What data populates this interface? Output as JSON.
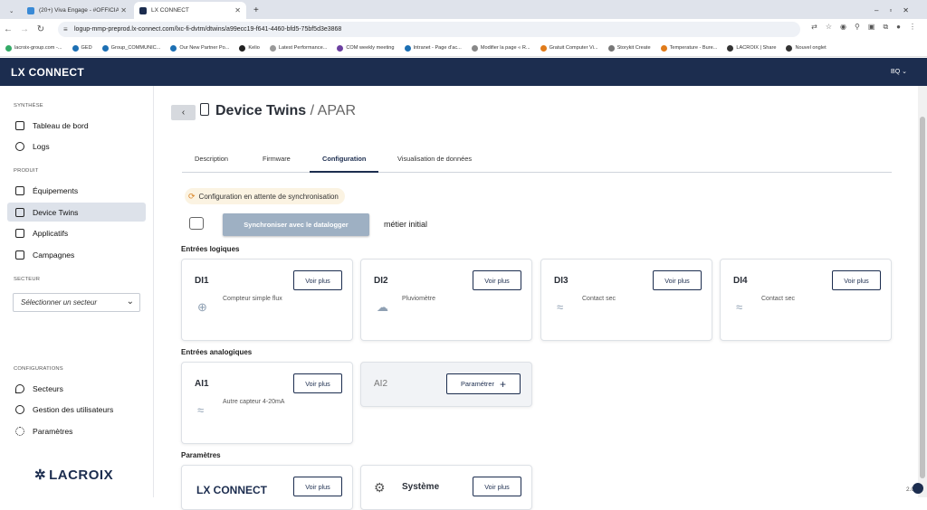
{
  "browser": {
    "tabs": [
      {
        "title": "(20+) Viva Engage - #OFFICIAL"
      },
      {
        "title": "LX CONNECT"
      }
    ],
    "url": "logup-mmp-preprod.lx-connect.com/lxc-fi-dvtm/dtwins/a99ecc19-f641-4460-bfd5-75bf5d3e3868",
    "bookmarks": [
      "lacroix-group.com -...",
      "GED",
      "Group_COMMUNIC...",
      "Our New Partner Po...",
      "Kelio",
      "Latest Performance...",
      "COM weekly meeting",
      "Intranet - Page d'ac...",
      "Modifier la page « R...",
      "Gratuit Computer Vi...",
      "Storykit Create",
      "Temperature - Bure...",
      "LACROIX | Share",
      "Nouvel onglet"
    ]
  },
  "app": {
    "brand": "LX CONNECT",
    "user": "BQ"
  },
  "sidebar": {
    "section_synthese": "SYNTHÈSE",
    "tableau": "Tableau de bord",
    "logs": "Logs",
    "section_produit": "PRODUIT",
    "equipements": "Équipements",
    "device_twins": "Device Twins",
    "applicatifs": "Applicatifs",
    "campagnes": "Campagnes",
    "section_secteur": "SECTEUR",
    "secteur_placeholder": "Sélectionner un secteur",
    "section_config": "CONFIGURATIONS",
    "secteurs": "Secteurs",
    "gestion": "Gestion des utilisateurs",
    "parametres": "Paramètres",
    "logo": "LACROIX"
  },
  "page": {
    "title": "Device Twins",
    "subtitle": "/ APAR",
    "tabs": [
      "Description",
      "Firmware",
      "Configuration",
      "Visualisation de données"
    ],
    "pending": "Configuration en attente de synchronisation",
    "sync_button": "Synchroniser avec le datalogger",
    "metier": "métier initial",
    "group_logiques": "Entrées logiques",
    "group_analogiques": "Entrées analogiques",
    "group_parametres": "Paramètres",
    "voir_plus": "Voir plus",
    "parametrer": "Paramétrer"
  },
  "logic_inputs": [
    {
      "name": "DI1",
      "desc": "Compteur simple flux"
    },
    {
      "name": "DI2",
      "desc": "Pluviomètre"
    },
    {
      "name": "DI3",
      "desc": "Contact sec"
    },
    {
      "name": "DI4",
      "desc": "Contact sec"
    }
  ],
  "analog_inputs": [
    {
      "name": "AI1",
      "desc": "Autre capteur 4-20mA"
    },
    {
      "name": "AI2",
      "desc": ""
    }
  ],
  "params": [
    {
      "name": "LX CONNECT"
    },
    {
      "name": "Système"
    }
  ],
  "version": "2.0"
}
